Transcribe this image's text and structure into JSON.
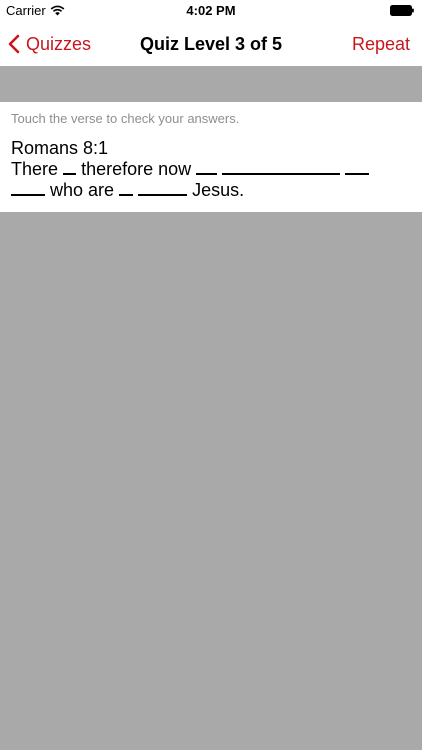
{
  "status_bar": {
    "carrier": "Carrier",
    "time": "4:02 PM",
    "icons": [
      "wifi-icon",
      "battery-icon"
    ]
  },
  "nav": {
    "back_label": "Quizzes",
    "title": "Quiz Level 3 of 5",
    "repeat_label": "Repeat",
    "accent_color": "#c8161d"
  },
  "quiz": {
    "hint": "Touch the verse to check your answers.",
    "reference": "Romans 8:1",
    "line1": {
      "w1": "There",
      "w2": "therefore now"
    },
    "line2": {
      "w1": "who are",
      "w2": "Jesus."
    },
    "blank_count": 7
  },
  "colors": {
    "background": "#a9a9a9",
    "card": "#ffffff",
    "hint_text": "#8e8e93"
  }
}
